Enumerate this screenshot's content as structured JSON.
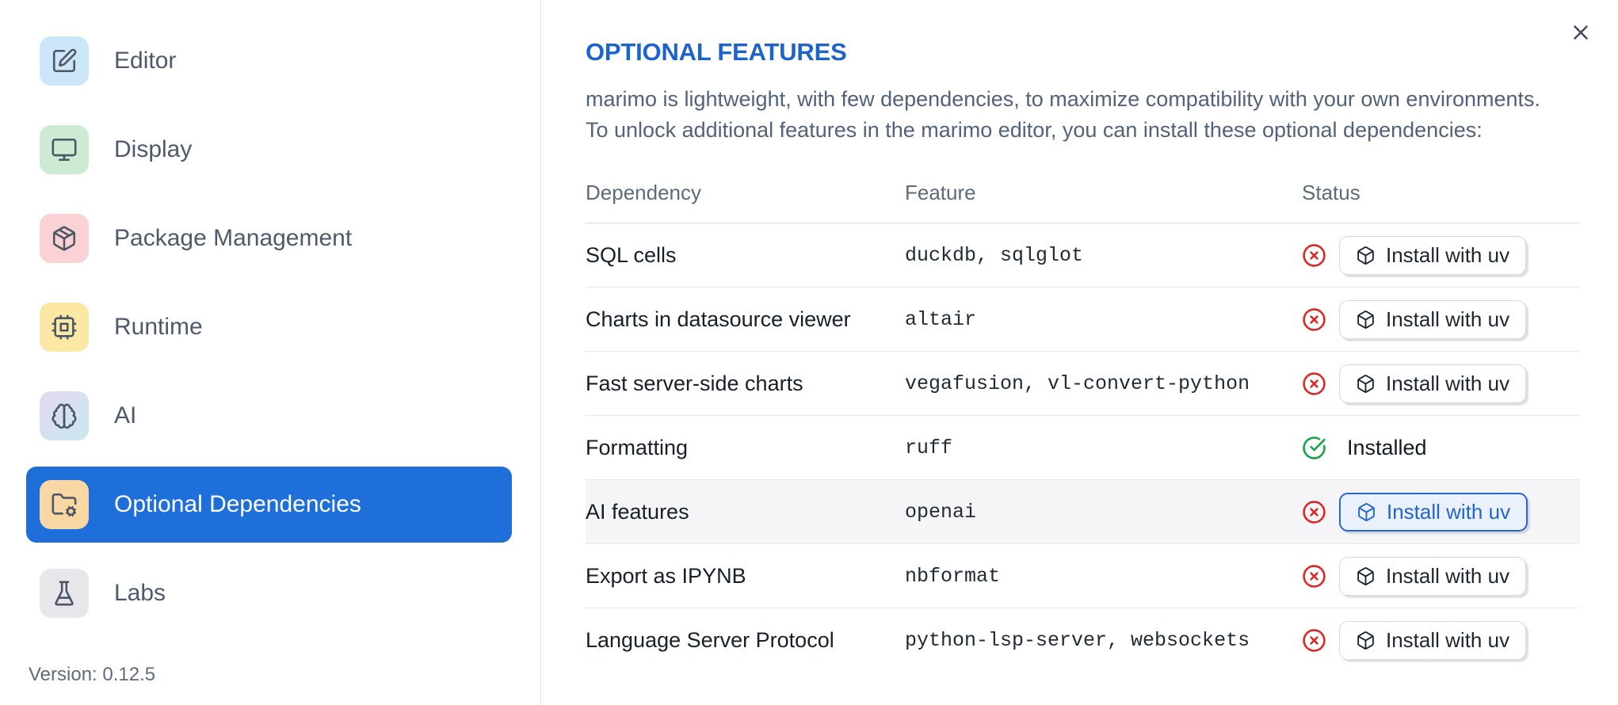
{
  "sidebar": {
    "items": [
      {
        "label": "Editor",
        "icon": "square-pen-icon",
        "icon_bg": "#CBE5F9",
        "selected": false
      },
      {
        "label": "Display",
        "icon": "monitor-icon",
        "icon_bg": "#CDEBD3",
        "selected": false
      },
      {
        "label": "Package Management",
        "icon": "package-icon",
        "icon_bg": "#FAD2D6",
        "selected": false
      },
      {
        "label": "Runtime",
        "icon": "cpu-icon",
        "icon_bg": "#FAE8A4",
        "selected": false
      },
      {
        "label": "AI",
        "icon": "brain-icon",
        "icon_bg": "linear-gradient(#E5D7F2,#C6E9EE)",
        "selected": false
      },
      {
        "label": "Optional Dependencies",
        "icon": "folder-cog-icon",
        "icon_bg": "#F8D7A4",
        "selected": true
      },
      {
        "label": "Labs",
        "icon": "flask-icon",
        "icon_bg": "#E7E7EB",
        "selected": false
      }
    ],
    "version": "Version: 0.12.5"
  },
  "main": {
    "title": "OPTIONAL FEATURES",
    "description_lines": [
      "marimo is lightweight, with few dependencies, to maximize compatibility with your own environments.",
      "To unlock additional features in the marimo editor, you can install these optional dependencies:"
    ],
    "table": {
      "columns": [
        "Dependency",
        "Feature",
        "Status"
      ],
      "rows": [
        {
          "dependency": "SQL cells",
          "feature": "duckdb, sqlglot",
          "status": "not-installed",
          "status_icon": "circle-x-icon",
          "action": "Install with uv"
        },
        {
          "dependency": "Charts in datasource viewer",
          "feature": "altair",
          "status": "not-installed",
          "status_icon": "circle-x-icon",
          "action": "Install with uv"
        },
        {
          "dependency": "Fast server-side charts",
          "feature": "vegafusion, vl-convert-python",
          "status": "not-installed",
          "status_icon": "circle-x-icon",
          "action": "Install with uv"
        },
        {
          "dependency": "Formatting",
          "feature": "ruff",
          "status": "installed",
          "status_icon": "circle-check-icon",
          "status_label": "Installed"
        },
        {
          "dependency": "AI features",
          "feature": "openai",
          "status": "not-installed",
          "status_icon": "circle-x-icon",
          "action": "Install with uv",
          "highlighted": true,
          "button_focused": true
        },
        {
          "dependency": "Export as IPYNB",
          "feature": "nbformat",
          "status": "not-installed",
          "status_icon": "circle-x-icon",
          "action": "Install with uv"
        },
        {
          "dependency": "Language Server Protocol",
          "feature": "python-lsp-server, websockets",
          "status": "not-installed",
          "status_icon": "circle-x-icon",
          "action": "Install with uv"
        }
      ]
    }
  },
  "colors": {
    "accent_blue_selected": "#1E6FD9",
    "title_blue": "#1D63CE",
    "error_red": "#DC2626",
    "success_green": "#16A34A",
    "focused_button_blue": "#2166CC",
    "highlighted_row_bg": "#F5F5F7"
  }
}
